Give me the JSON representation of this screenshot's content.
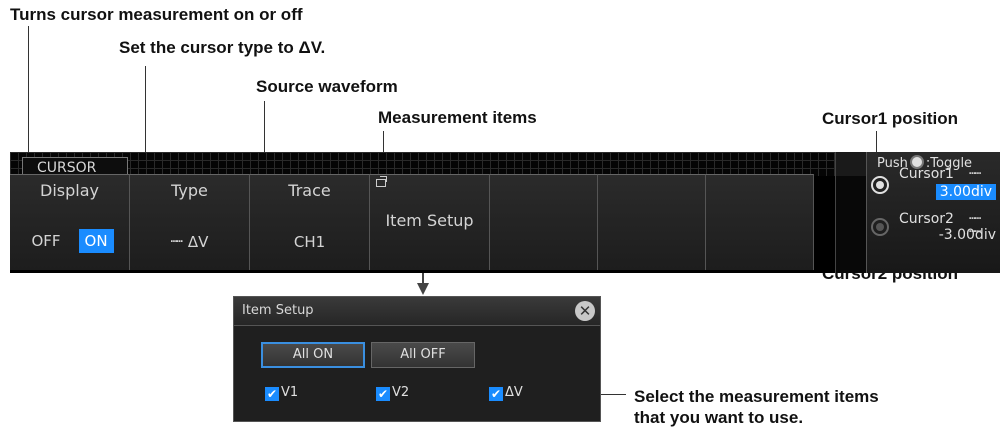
{
  "annotations": {
    "display": "Turns cursor measurement on or off",
    "type": "Set the cursor type to ΔV.",
    "trace": "Source waveform",
    "items": "Measurement items",
    "cursor1": "Cursor1 position",
    "cursor2": "Cursor2 position",
    "select_line1": "Select the measurement items",
    "select_line2": "that you want to use."
  },
  "menu": {
    "tab": "CURSOR",
    "display": {
      "title": "Display",
      "off": "OFF",
      "on": "ON",
      "selected": "ON"
    },
    "type": {
      "title": "Type",
      "value": "ΔV"
    },
    "trace": {
      "title": "Trace",
      "value": "CH1"
    },
    "item_setup": {
      "label": "Item Setup"
    }
  },
  "cursor_panel": {
    "push_text": "Push",
    "toggle_text": ":Toggle",
    "cursor1": {
      "label": "Cursor1",
      "value": "3.00div",
      "active": true
    },
    "cursor2": {
      "label": "Cursor2",
      "value": "-3.00div",
      "active": false
    }
  },
  "dialog": {
    "title": "Item Setup",
    "all_on": "All ON",
    "all_off": "All OFF",
    "items": [
      {
        "label": "V1",
        "checked": true
      },
      {
        "label": "V2",
        "checked": true
      },
      {
        "label": "ΔV",
        "checked": true
      }
    ]
  },
  "colors": {
    "accent": "#1a8cff",
    "bar_bg": "#000000",
    "key_bg": "#2b2b2b"
  }
}
